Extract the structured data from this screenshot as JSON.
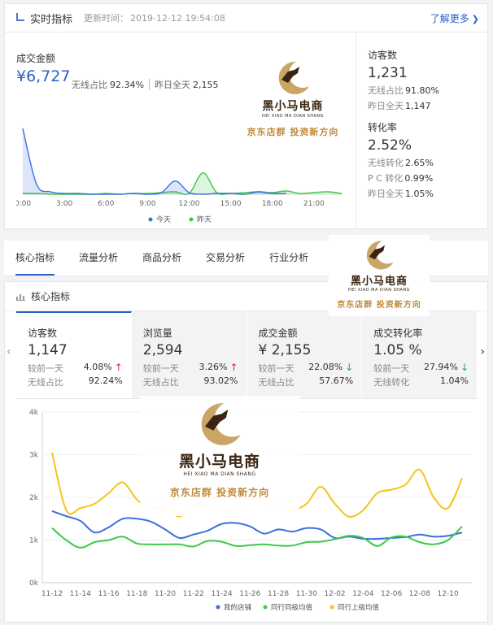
{
  "realtime": {
    "title": "实时指标",
    "update_label": "更新时间：",
    "update_time": "2019-12-12 19:54:08",
    "learn_more": "了解更多",
    "sales": {
      "label": "成交金额",
      "value": "¥6,727",
      "wireless_label": "无线占比",
      "wireless_value": "92.34%",
      "yesterday_label": "昨日全天",
      "yesterday_value": "2,155"
    },
    "visitors": {
      "label": "访客数",
      "value": "1,231",
      "wireless_label": "无线占比",
      "wireless_value": "91.80%",
      "yesterday_label": "昨日全天",
      "yesterday_value": "1,147"
    },
    "conversion": {
      "label": "转化率",
      "value": "2.52%",
      "wireless_label": "无线转化",
      "wireless_value": "2.65%",
      "pc_label": "P C 转化",
      "pc_value": "0.99%",
      "yesterday_label": "昨日全天",
      "yesterday_value": "1.05%"
    }
  },
  "tabs": [
    {
      "label": "核心指标",
      "active": true
    },
    {
      "label": "流量分析"
    },
    {
      "label": "商品分析"
    },
    {
      "label": "交易分析"
    },
    {
      "label": "行业分析"
    }
  ],
  "core": {
    "title": "核心指标",
    "metrics": [
      {
        "label": "访客数",
        "value": "1,147",
        "cmp_label": "较前一天",
        "cmp_value": "4.08%",
        "trend": "up",
        "wl_label": "无线占比",
        "wl_value": "92.24%"
      },
      {
        "label": "浏览量",
        "value": "2,594",
        "cmp_label": "较前一天",
        "cmp_value": "3.26%",
        "trend": "up",
        "wl_label": "无线占比",
        "wl_value": "93.02%"
      },
      {
        "label": "成交金额",
        "value": "¥ 2,155",
        "cmp_label": "较前一天",
        "cmp_value": "22.08%",
        "trend": "down",
        "wl_label": "无线占比",
        "wl_value": "57.67%"
      },
      {
        "label": "成交转化率",
        "value": "1.05 %",
        "cmp_label": "较前一天",
        "cmp_value": "27.94%",
        "trend": "down",
        "wl_label": "无线转化",
        "wl_value": "1.04%"
      }
    ]
  },
  "watermark": {
    "name": "黑小马电商",
    "en": "HEI XIAO MA DIAN SHANG",
    "slogan": "京东店群 投资新方向"
  },
  "colors": {
    "accent": "#2a62c9",
    "series_blue": "#3b6fe0",
    "series_green": "#3cc94a",
    "series_yellow": "#f5c518",
    "up": "#ee2222",
    "down": "#2aa54a"
  },
  "chart_data": [
    {
      "type": "area",
      "x": [
        "0:00",
        "1:00",
        "2:00",
        "3:00",
        "4:00",
        "5:00",
        "6:00",
        "7:00",
        "8:00",
        "9:00",
        "10:00",
        "11:00",
        "12:00",
        "13:00",
        "14:00",
        "15:00",
        "16:00",
        "17:00",
        "18:00",
        "19:00",
        "20:00",
        "21:00",
        "22:00",
        "23:00"
      ],
      "x_ticks": [
        "0:00",
        "3:00",
        "6:00",
        "9:00",
        "12:00",
        "15:00",
        "18:00",
        "21:00"
      ],
      "series": [
        {
          "name": "今天",
          "color": "#3b6fe0",
          "values": [
            80,
            12,
            3,
            1,
            1,
            0,
            0,
            0,
            1,
            0,
            2,
            16,
            2,
            0,
            1,
            1,
            0,
            3,
            1,
            1
          ]
        },
        {
          "name": "昨天",
          "color": "#3cc94a",
          "values": [
            1,
            1,
            0,
            0,
            0,
            0,
            1,
            0,
            1,
            1,
            2,
            3,
            1,
            26,
            2,
            1,
            2,
            3,
            2,
            4,
            1,
            2,
            3,
            1
          ]
        }
      ],
      "legend_position": "bottom"
    },
    {
      "type": "line",
      "x": [
        "11-12",
        "11-13",
        "11-14",
        "11-15",
        "11-16",
        "11-17",
        "11-18",
        "11-19",
        "11-20",
        "11-21",
        "11-22",
        "11-23",
        "11-24",
        "11-25",
        "11-26",
        "11-27",
        "11-28",
        "11-29",
        "11-30",
        "12-01",
        "12-02",
        "12-03",
        "12-04",
        "12-05",
        "12-06",
        "12-07",
        "12-08",
        "12-09",
        "12-10",
        "12-11"
      ],
      "x_ticks": [
        "11-12",
        "11-14",
        "11-16",
        "11-18",
        "11-20",
        "11-22",
        "11-24",
        "11-26",
        "11-28",
        "11-30",
        "12-02",
        "12-04",
        "12-06",
        "12-08",
        "12-10"
      ],
      "y_ticks": [
        "0k",
        "1k",
        "2k",
        "3k",
        "4k"
      ],
      "ylim": [
        0,
        4000
      ],
      "series": [
        {
          "name": "我的店铺",
          "color": "#3b6fe0",
          "values": [
            1680,
            1560,
            1450,
            1180,
            1300,
            1500,
            1500,
            1430,
            1250,
            1050,
            1130,
            1220,
            1380,
            1400,
            1320,
            1150,
            1250,
            1200,
            1280,
            1250,
            1050,
            1080,
            1030,
            1030,
            1050,
            1070,
            1130,
            1080,
            1100,
            1180
          ]
        },
        {
          "name": "同行同级均值",
          "color": "#3cc94a",
          "values": [
            1280,
            1000,
            820,
            950,
            1000,
            1080,
            920,
            900,
            900,
            900,
            850,
            980,
            960,
            860,
            880,
            900,
            870,
            870,
            950,
            960,
            1020,
            1100,
            1050,
            860,
            1060,
            1080,
            950,
            900,
            1000,
            1320
          ]
        },
        {
          "name": "同行上级均值",
          "color": "#f5c518",
          "values": [
            3050,
            1700,
            1750,
            1850,
            2100,
            2350,
            1950,
            1750,
            1780,
            1550,
            1830,
            1800,
            1700,
            1720,
            1950,
            1880,
            1750,
            1700,
            1850,
            2250,
            1850,
            1550,
            1700,
            2100,
            2180,
            2300,
            2650,
            2000,
            1750,
            2450
          ]
        }
      ],
      "legend_position": "bottom"
    }
  ]
}
